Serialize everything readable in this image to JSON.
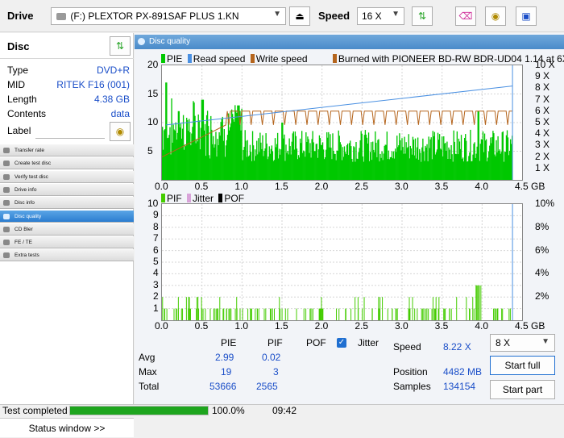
{
  "toolbar": {
    "drive_label": "Drive",
    "drive_value": "(F:)   PLEXTOR PX-891SAF PLUS 1.KN",
    "speed_label": "Speed",
    "speed_value": "16 X"
  },
  "disc": {
    "header": "Disc",
    "rows": [
      {
        "key": "Type",
        "value": "DVD+R"
      },
      {
        "key": "MID",
        "value": "RITEK F16 (001)"
      },
      {
        "key": "Length",
        "value": "4.38 GB"
      },
      {
        "key": "Contents",
        "value": "data"
      }
    ],
    "label_key": "Label"
  },
  "nav": [
    {
      "label": "Transfer rate",
      "active": false
    },
    {
      "label": "Create test disc",
      "active": false
    },
    {
      "label": "Verify test disc",
      "active": false
    },
    {
      "label": "Drive info",
      "active": false
    },
    {
      "label": "Disc info",
      "active": false
    },
    {
      "label": "Disc quality",
      "active": true
    },
    {
      "label": "CD Bler",
      "active": false
    },
    {
      "label": "FE / TE",
      "active": false
    },
    {
      "label": "Extra tests",
      "active": false
    }
  ],
  "status_window_label": "Status window >>",
  "main_title": "Disc quality",
  "chart_data": [
    {
      "type": "bar",
      "legend": [
        "PIE",
        "Read speed",
        "Write speed",
        "Burned with PIONEER BD-RW   BDR-UD04 1.14 at 6X"
      ],
      "x_ticks": [
        "0.0",
        "0.5",
        "1.0",
        "1.5",
        "2.0",
        "2.5",
        "3.0",
        "3.5",
        "4.0",
        "4.5 GB"
      ],
      "y_left_ticks": [
        "20",
        "15",
        "10",
        "5"
      ],
      "y_right_ticks": [
        "10 X",
        "9 X",
        "8 X",
        "7 X",
        "6 X",
        "5 X",
        "4 X",
        "3 X",
        "2 X",
        "1 X"
      ],
      "xlim": [
        0,
        4.5
      ],
      "ylim": [
        0,
        20
      ],
      "y2lim": [
        0,
        10
      ],
      "pie_peaks": [
        [
          0.05,
          17
        ],
        [
          0.2,
          12
        ],
        [
          0.5,
          14
        ],
        [
          0.95,
          13
        ],
        [
          1.5,
          10
        ],
        [
          3.95,
          12
        ]
      ],
      "pie_baseline": 7,
      "write_speed_level": 6,
      "read_speed_start": 4.8,
      "read_speed_end": 8.2,
      "colors": {
        "pie": "#00c800",
        "read": "#4a90e2",
        "write": "#b5651d"
      }
    },
    {
      "type": "bar",
      "legend": [
        "PIF",
        "Jitter",
        "POF"
      ],
      "x_ticks": [
        "0.0",
        "0.5",
        "1.0",
        "1.5",
        "2.0",
        "2.5",
        "3.0",
        "3.5",
        "4.0",
        "4.5 GB"
      ],
      "y_left_ticks": [
        "10",
        "9",
        "8",
        "7",
        "6",
        "5",
        "4",
        "3",
        "2",
        "1"
      ],
      "y_right_ticks": [
        "10%",
        "8%",
        "6%",
        "4%",
        "2%"
      ],
      "xlim": [
        0,
        4.5
      ],
      "ylim": [
        0,
        10
      ],
      "pif_max": 3,
      "colors": {
        "pif": "#44cc00",
        "jitter": "#d9a3d9",
        "pof": "#000000"
      }
    }
  ],
  "stats": {
    "col_pie": "PIE",
    "col_pif": "PIF",
    "col_pof": "POF",
    "jitter_label": "Jitter",
    "avg_label": "Avg",
    "max_label": "Max",
    "total_label": "Total",
    "avg_pie": "2.99",
    "avg_pif": "0.02",
    "max_pie": "19",
    "max_pif": "3",
    "total_pie": "53666",
    "total_pif": "2565",
    "speed_label": "Speed",
    "speed_value": "8.22 X",
    "position_label": "Position",
    "position_value": "4482 MB",
    "samples_label": "Samples",
    "samples_value": "134154",
    "test_speed": "8 X",
    "start_full": "Start full",
    "start_part": "Start part"
  },
  "statusbar": {
    "status": "Test completed",
    "progress": 100,
    "progress_text": "100.0%",
    "time": "09:42"
  }
}
